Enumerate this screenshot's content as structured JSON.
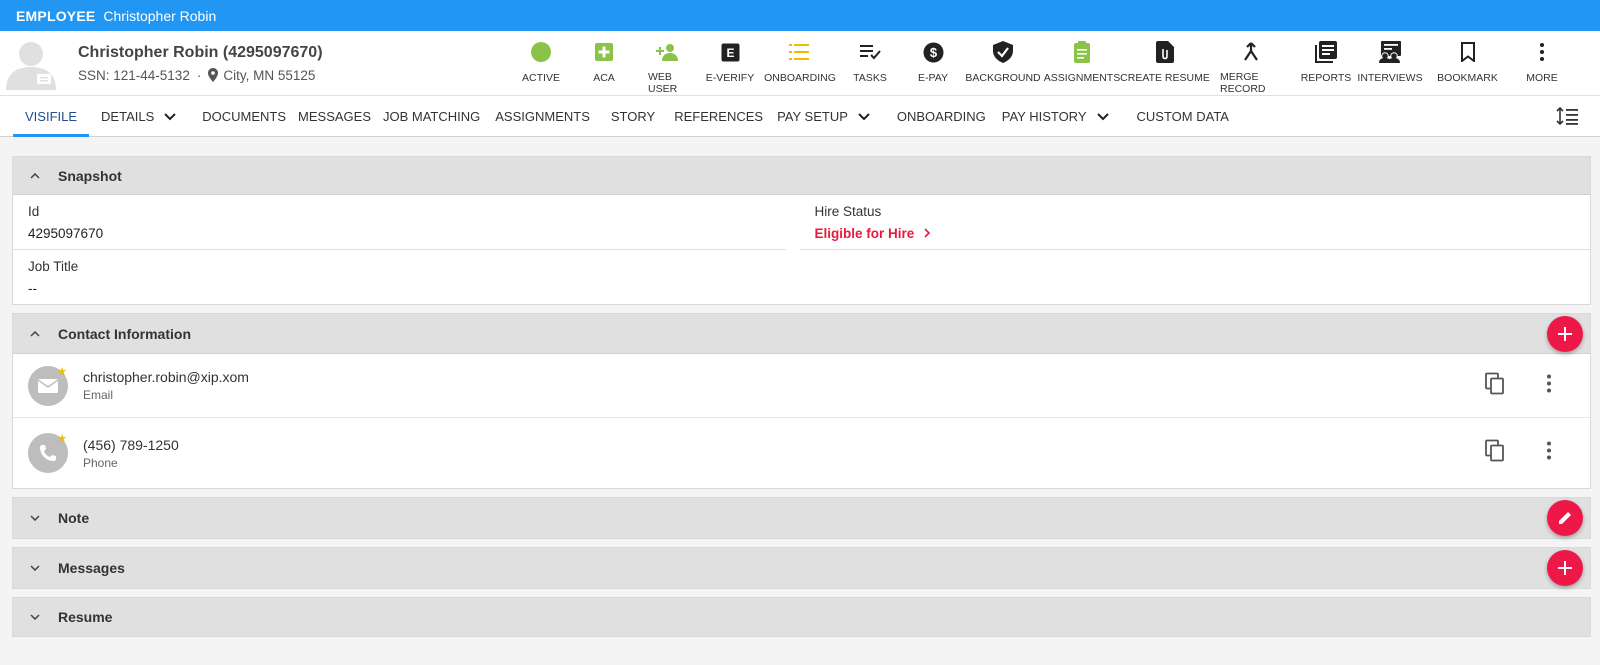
{
  "topbar": {
    "kind": "EMPLOYEE",
    "name": "Christopher Robin"
  },
  "header": {
    "title": "Christopher Robin (4295097670)",
    "ssn": "SSN: 121-44-5132",
    "location": "City, MN 55125"
  },
  "actions": [
    {
      "label": "ACTIVE",
      "icon": "active-status-icon",
      "color": "#8bc34a"
    },
    {
      "label": "ACA",
      "icon": "aca-plus-icon",
      "color": "#8bc34a"
    },
    {
      "label": "WEB USER",
      "icon": "web-user-icon",
      "color": "#8bc34a"
    },
    {
      "label": "E-VERIFY",
      "icon": "e-verify-icon",
      "color": "#222222"
    },
    {
      "label": "ONBOARDING",
      "icon": "onboarding-list-icon",
      "color": "#f5b800"
    },
    {
      "label": "TASKS",
      "icon": "tasks-icon",
      "color": "#222222"
    },
    {
      "label": "E-PAY",
      "icon": "e-pay-icon",
      "color": "#222222"
    },
    {
      "label": "BACKGROUND",
      "icon": "background-shield-icon",
      "color": "#222222"
    },
    {
      "label": "ASSIGNMENTS",
      "icon": "assignments-clipboard-icon",
      "color": "#8bc34a"
    },
    {
      "label": "CREATE RESUME",
      "icon": "create-resume-icon",
      "color": "#222222"
    },
    {
      "label": "MERGE RECORD",
      "icon": "merge-icon",
      "color": "#222222"
    },
    {
      "label": "REPORTS",
      "icon": "reports-icon",
      "color": "#222222"
    },
    {
      "label": "INTERVIEWS",
      "icon": "interviews-icon",
      "color": "#222222"
    },
    {
      "label": "BOOKMARK",
      "icon": "bookmark-icon",
      "color": "#222222"
    },
    {
      "label": "MORE",
      "icon": "more-vertical-icon",
      "color": "#222222"
    }
  ],
  "tabs": [
    {
      "label": "VISIFILE",
      "active": true
    },
    {
      "label": "DETAILS",
      "dropdown": true
    },
    {
      "label": "DOCUMENTS"
    },
    {
      "label": "MESSAGES"
    },
    {
      "label": "JOB MATCHING"
    },
    {
      "label": "ASSIGNMENTS"
    },
    {
      "label": "STORY"
    },
    {
      "label": "REFERENCES"
    },
    {
      "label": "PAY SETUP",
      "dropdown": true
    },
    {
      "label": "ONBOARDING"
    },
    {
      "label": "PAY HISTORY",
      "dropdown": true
    },
    {
      "label": "CUSTOM DATA"
    }
  ],
  "snapshot": {
    "title": "Snapshot",
    "id_label": "Id",
    "id_value": "4295097670",
    "hire_label": "Hire Status",
    "hire_value": "Eligible for Hire",
    "job_label": "Job Title",
    "job_value": "--"
  },
  "contact": {
    "title": "Contact Information",
    "items": [
      {
        "value": "christopher.robin@xip.xom",
        "type": "Email"
      },
      {
        "value": "(456) 789-1250",
        "type": "Phone"
      }
    ]
  },
  "sections": {
    "note": "Note",
    "messages": "Messages",
    "resume": "Resume"
  },
  "colors": {
    "brand": "#2196f3",
    "accent": "#ee1848",
    "hire": "#e8193c",
    "ok": "#8bc34a",
    "warn": "#f5b800"
  }
}
